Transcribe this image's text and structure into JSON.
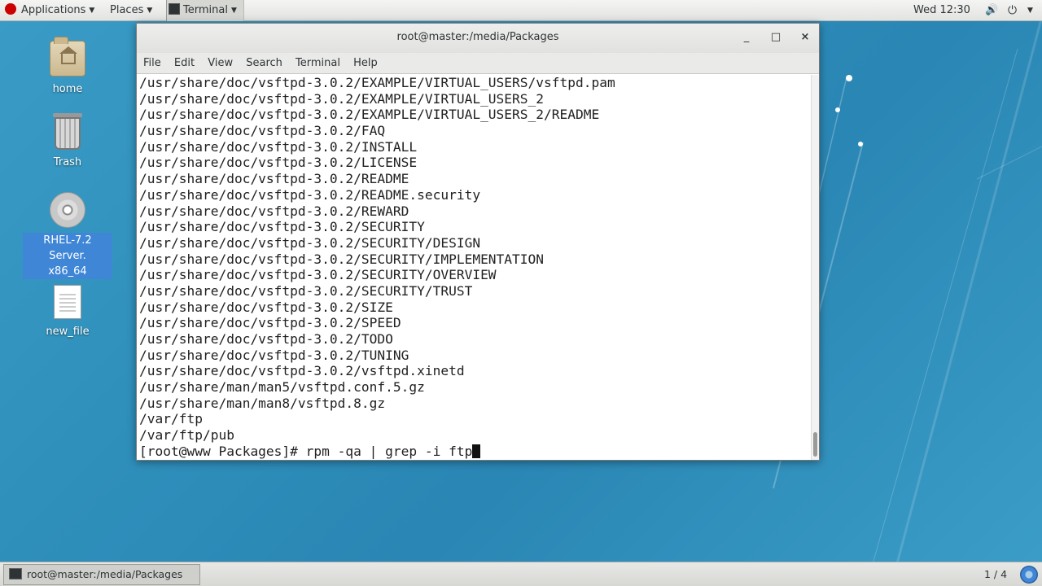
{
  "topbar": {
    "applications_label": "Applications",
    "places_label": "Places",
    "terminal_label": "Terminal",
    "clock": "Wed 12:30",
    "volume_icon": "volume-icon",
    "power_icon": "power-icon"
  },
  "desktop": {
    "icons": [
      {
        "label": "home",
        "icon": "home-folder-icon"
      },
      {
        "label": "Trash",
        "icon": "trash-icon"
      },
      {
        "label_line1": "RHEL-7.2 Server.",
        "label_line2": "x86_64",
        "icon": "disc-icon",
        "selected": true
      },
      {
        "label": "new_file",
        "icon": "file-icon"
      }
    ]
  },
  "window": {
    "title": "root@master:/media/Packages",
    "controls": {
      "minimize": "_",
      "maximize": "□",
      "close": "×"
    },
    "menu": [
      "File",
      "Edit",
      "View",
      "Search",
      "Terminal",
      "Help"
    ],
    "lines": [
      "/usr/share/doc/vsftpd-3.0.2/EXAMPLE/VIRTUAL_USERS/vsftpd.pam",
      "/usr/share/doc/vsftpd-3.0.2/EXAMPLE/VIRTUAL_USERS_2",
      "/usr/share/doc/vsftpd-3.0.2/EXAMPLE/VIRTUAL_USERS_2/README",
      "/usr/share/doc/vsftpd-3.0.2/FAQ",
      "/usr/share/doc/vsftpd-3.0.2/INSTALL",
      "/usr/share/doc/vsftpd-3.0.2/LICENSE",
      "/usr/share/doc/vsftpd-3.0.2/README",
      "/usr/share/doc/vsftpd-3.0.2/README.security",
      "/usr/share/doc/vsftpd-3.0.2/REWARD",
      "/usr/share/doc/vsftpd-3.0.2/SECURITY",
      "/usr/share/doc/vsftpd-3.0.2/SECURITY/DESIGN",
      "/usr/share/doc/vsftpd-3.0.2/SECURITY/IMPLEMENTATION",
      "/usr/share/doc/vsftpd-3.0.2/SECURITY/OVERVIEW",
      "/usr/share/doc/vsftpd-3.0.2/SECURITY/TRUST",
      "/usr/share/doc/vsftpd-3.0.2/SIZE",
      "/usr/share/doc/vsftpd-3.0.2/SPEED",
      "/usr/share/doc/vsftpd-3.0.2/TODO",
      "/usr/share/doc/vsftpd-3.0.2/TUNING",
      "/usr/share/doc/vsftpd-3.0.2/vsftpd.xinetd",
      "/usr/share/man/man5/vsftpd.conf.5.gz",
      "/usr/share/man/man8/vsftpd.8.gz",
      "/var/ftp",
      "/var/ftp/pub"
    ],
    "prompt": "[root@www Packages]# ",
    "command": "rpm -qa | grep -i ftp"
  },
  "taskbar": {
    "task_label": "root@master:/media/Packages",
    "workspace": "1 / 4"
  }
}
